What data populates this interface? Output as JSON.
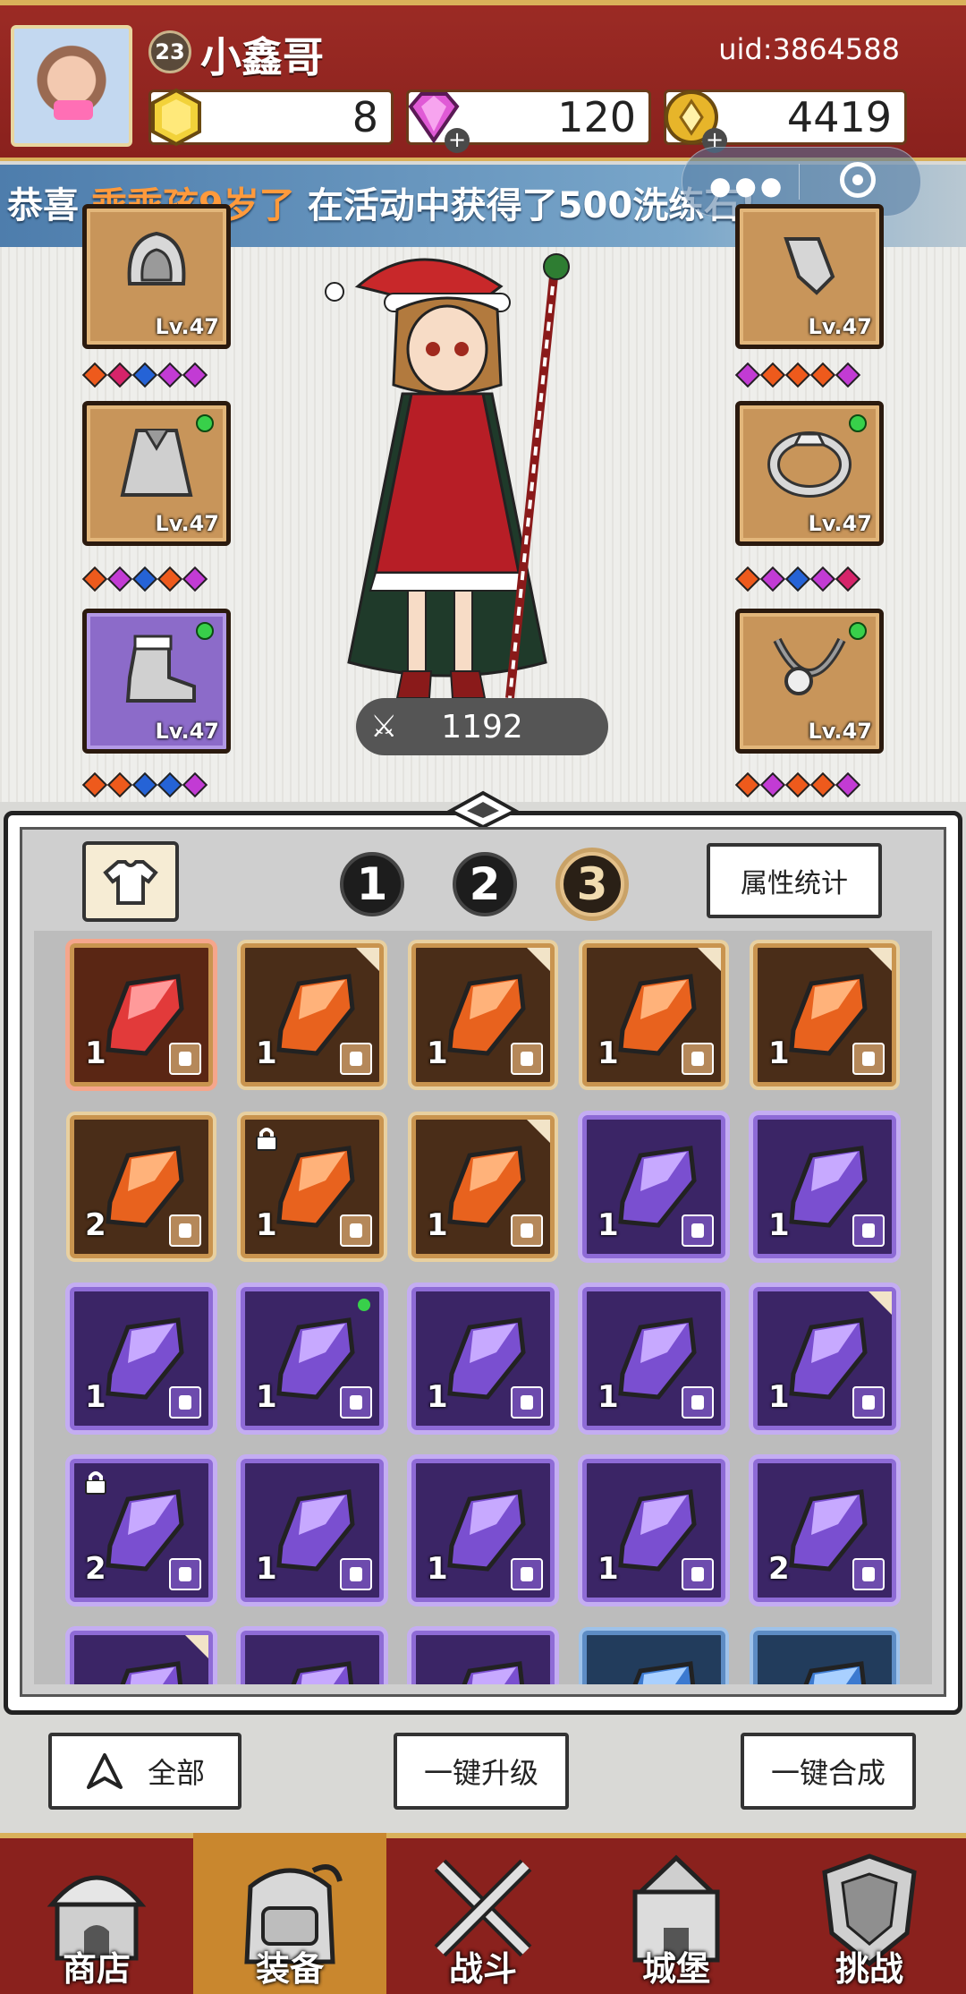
{
  "header": {
    "player_level": "23",
    "player_name": "小鑫哥",
    "uid": "uid:3864588",
    "resources": [
      {
        "icon": "gold-gem-icon",
        "value": "8"
      },
      {
        "icon": "diamond-icon",
        "value": "120"
      },
      {
        "icon": "coin-icon",
        "value": "4419"
      }
    ]
  },
  "banner": {
    "prefix": "恭喜 ",
    "highlight": "乖乖孩9岁了",
    "suffix": " 在活动中获得了500洗练石!"
  },
  "equipment": {
    "slots": [
      {
        "side": "left",
        "icon": "hood-icon",
        "level": "Lv.47",
        "gems": [
          "#ee5a1c",
          "#d6246a",
          "#2563d6",
          "#c23bd4",
          "#c23bd4"
        ],
        "new": false
      },
      {
        "side": "left",
        "icon": "cape-icon",
        "level": "Lv.47",
        "gems": [
          "#ee5a1c",
          "#c23bd4",
          "#2563d6",
          "#ee5a1c",
          "#c23bd4"
        ],
        "new": true
      },
      {
        "side": "left",
        "icon": "boots-icon",
        "level": "Lv.47",
        "gems": [
          "#ee5a1c",
          "#ee5a1c",
          "#2563d6",
          "#2563d6",
          "#c23bd4"
        ],
        "new": true
      },
      {
        "side": "right",
        "icon": "glove-icon",
        "level": "Lv.47",
        "gems": [
          "#c23bd4",
          "#ee5a1c",
          "#ee5a1c",
          "#ee5a1c",
          "#c23bd4"
        ],
        "new": false
      },
      {
        "side": "right",
        "icon": "ring-icon",
        "level": "Lv.47",
        "gems": [
          "#ee5a1c",
          "#c23bd4",
          "#2563d6",
          "#c23bd4",
          "#d6246a"
        ],
        "new": true
      },
      {
        "side": "right",
        "icon": "necklace-icon",
        "level": "Lv.47",
        "gems": [
          "#ee5a1c",
          "#c23bd4",
          "#ee5a1c",
          "#ee5a1c",
          "#c23bd4"
        ],
        "new": true
      }
    ],
    "power": "1192"
  },
  "inventory": {
    "pages": [
      "1",
      "2",
      "3"
    ],
    "active_page": 2,
    "stats_button": "属性统计",
    "items": [
      {
        "rarity": "red",
        "count": "1"
      },
      {
        "rarity": "orange",
        "count": "1",
        "corner": true
      },
      {
        "rarity": "orange",
        "count": "1",
        "corner": true
      },
      {
        "rarity": "orange",
        "count": "1",
        "corner": true
      },
      {
        "rarity": "orange",
        "count": "1",
        "corner": true
      },
      {
        "rarity": "orange",
        "count": "2"
      },
      {
        "rarity": "orange",
        "count": "1",
        "locked": true
      },
      {
        "rarity": "orange",
        "count": "1",
        "corner": true
      },
      {
        "rarity": "purple",
        "count": "1"
      },
      {
        "rarity": "purple",
        "count": "1"
      },
      {
        "rarity": "purple",
        "count": "1"
      },
      {
        "rarity": "purple",
        "count": "1",
        "new": true
      },
      {
        "rarity": "purple",
        "count": "1"
      },
      {
        "rarity": "purple",
        "count": "1"
      },
      {
        "rarity": "purple",
        "count": "1",
        "corner": true
      },
      {
        "rarity": "purple",
        "count": "2",
        "locked": true
      },
      {
        "rarity": "purple",
        "count": "1"
      },
      {
        "rarity": "purple",
        "count": "1"
      },
      {
        "rarity": "purple",
        "count": "1"
      },
      {
        "rarity": "purple",
        "count": "2"
      },
      {
        "rarity": "purple",
        "count": "",
        "corner": true
      },
      {
        "rarity": "purple",
        "count": ""
      },
      {
        "rarity": "purple",
        "count": ""
      },
      {
        "rarity": "blue",
        "count": ""
      },
      {
        "rarity": "blue",
        "count": ""
      }
    ]
  },
  "actions": {
    "all": "全部",
    "upgrade": "一键升级",
    "merge": "一键合成"
  },
  "nav": [
    {
      "label": "商店",
      "icon": "shop-icon"
    },
    {
      "label": "装备",
      "icon": "backpack-icon"
    },
    {
      "label": "战斗",
      "icon": "crossed-swords-icon"
    },
    {
      "label": "城堡",
      "icon": "castle-icon"
    },
    {
      "label": "挑战",
      "icon": "shield-icon"
    }
  ],
  "colors": {
    "header_red": "#8a211d",
    "gold_trim": "#d9b15a",
    "nav_active": "#c9872e"
  }
}
